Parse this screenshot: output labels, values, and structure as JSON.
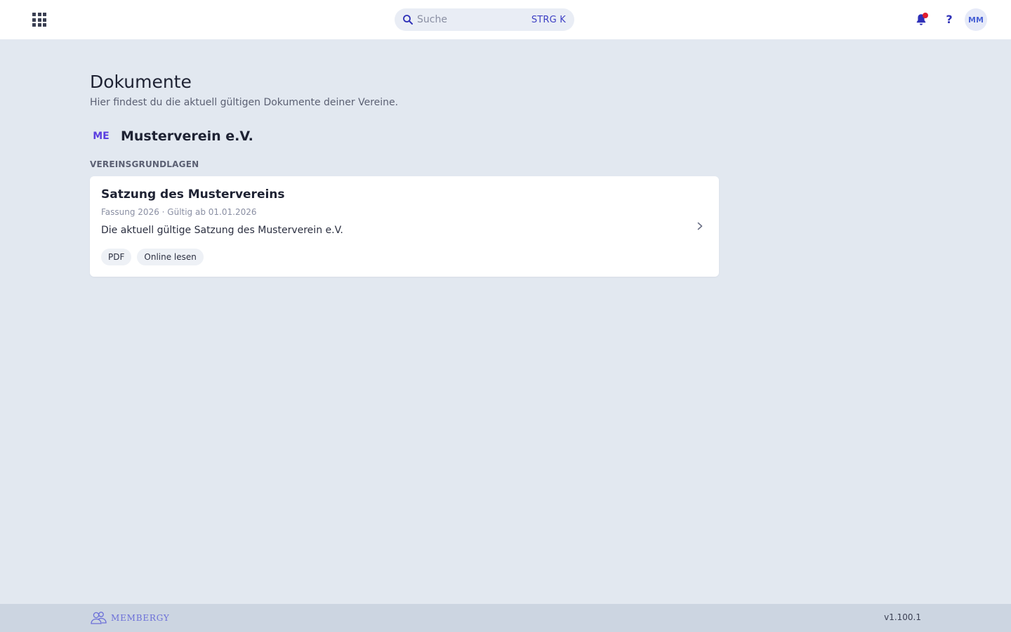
{
  "header": {
    "search": {
      "placeholder": "Suche",
      "shortcut": "STRG K"
    },
    "help_label": "?",
    "avatar_initials": "MM",
    "has_notification": true
  },
  "main": {
    "title": "Dokumente",
    "subtitle": "Hier findest du die aktuell gültigen Dokumente deiner Vereine.",
    "club": {
      "badge": "ME",
      "name": "Musterverein e.V."
    },
    "section_label": "VEREINSGRUNDLAGEN",
    "documents": [
      {
        "title": "Satzung des Mustervereins",
        "meta": "Fassung 2026 · Gültig ab 01.01.2026",
        "description": "Die aktuell gültige Satzung des Musterverein e.V.",
        "tags": [
          "PDF",
          "Online lesen"
        ]
      }
    ]
  },
  "footer": {
    "logo_text": "MEMBERGY",
    "version": "v1.100.1"
  },
  "colors": {
    "accent": "#3d3fc4",
    "badge": "#5b3fe0",
    "notification": "#e11d2e",
    "background": "#e2e8f0",
    "footer": "#ccd5e1"
  }
}
